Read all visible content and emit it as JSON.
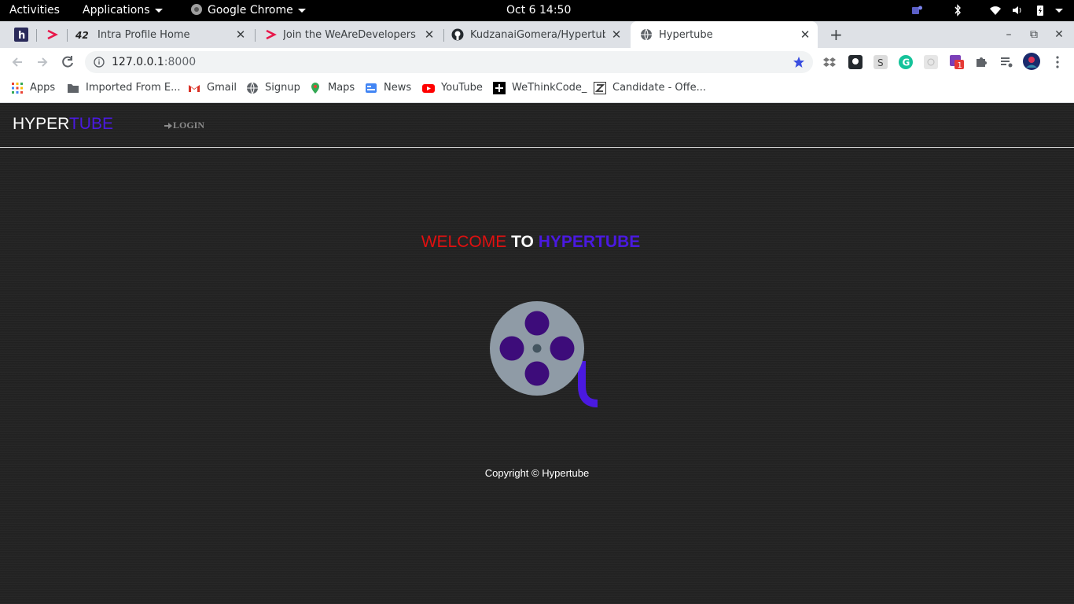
{
  "topbar": {
    "activities": "Activities",
    "applications": "Applications",
    "app_name": "Google Chrome",
    "clock": "Oct 6  14:50"
  },
  "tabs": [
    {
      "title": "",
      "favicon": "h-icon"
    },
    {
      "title": "",
      "favicon": "wearedevelopers-icon"
    },
    {
      "title": "Intra Profile Home",
      "favicon": "42-icon"
    },
    {
      "title": "Join the WeAreDevelopers Li",
      "favicon": "wearedevelopers-icon"
    },
    {
      "title": "KudzanaiGomera/Hypertube:",
      "favicon": "github-icon"
    },
    {
      "title": "Hypertube",
      "favicon": "globe-icon",
      "active": true
    }
  ],
  "toolbar": {
    "url_host": "127.0.0.1",
    "url_port": ":8000"
  },
  "bookmarks": [
    {
      "label": "Apps",
      "icon": "apps-grid-icon"
    },
    {
      "label": "Imported From E...",
      "icon": "folder-icon"
    },
    {
      "label": "Gmail",
      "icon": "gmail-icon"
    },
    {
      "label": "Signup",
      "icon": "globe-icon"
    },
    {
      "label": "Maps",
      "icon": "maps-icon"
    },
    {
      "label": "News",
      "icon": "news-icon"
    },
    {
      "label": "YouTube",
      "icon": "youtube-icon"
    },
    {
      "label": "WeThinkCode_",
      "icon": "wethinkcode-icon"
    },
    {
      "label": "Candidate - Offe...",
      "icon": "zeta-icon"
    }
  ],
  "site": {
    "logo_part1": "HYPER",
    "logo_part2": "TUBE",
    "login_label": "LOGIN",
    "welcome_part1": "WELCOME",
    "welcome_part2": "TO",
    "welcome_part3": "HYPERTUBE",
    "copyright": "Copyright © Hypertube"
  },
  "colors": {
    "accent_purple": "#4a19e0",
    "welcome_red": "#e01010",
    "reel_gray": "#8f9ba6",
    "reel_holes": "#3d0c7a",
    "page_bg": "#222222"
  }
}
